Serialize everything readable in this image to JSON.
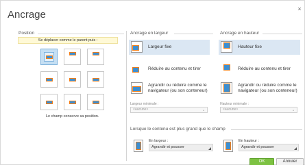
{
  "dialog": {
    "title": "Ancrage",
    "close": "×"
  },
  "position": {
    "label": "Position",
    "hint": "Se déplacer comme le parent puis :",
    "caption": "Le champ conserve sa position."
  },
  "width_anchor": {
    "label": "Ancrage en largeur",
    "options": [
      {
        "label": "Largeur fixe",
        "selected": true
      },
      {
        "label": "Réduire au contenu et tirer",
        "selected": false
      },
      {
        "label": "Agrandir ou réduire comme le navigateur (ou son conteneur)",
        "selected": false
      }
    ],
    "min_label": "Largeur minimale :",
    "min_value": "<aucune>"
  },
  "height_anchor": {
    "label": "Ancrage en hauteur",
    "options": [
      {
        "label": "Hauteur fixe",
        "selected": true
      },
      {
        "label": "Réduire au contenu et tirer",
        "selected": false
      },
      {
        "label": "Agrandir ou réduire comme le navigateur (ou son conteneur)",
        "selected": false
      }
    ],
    "min_label": "Hauteur minimale :",
    "min_value": "<aucune>"
  },
  "overflow": {
    "label": "Lorsque le contenu est plus grand que le champ",
    "width_label": "En largeur :",
    "width_value": "Agrandir et pousser",
    "height_label": "En hauteur :",
    "height_value": "Agrandir et pousser"
  },
  "buttons": {
    "ok": "OK",
    "cancel": "Annuler"
  },
  "colors": {
    "accent": "#3d8fd1",
    "border_accent": "#f07f1b",
    "ok_button": "#7dc242",
    "selection": "#dbe7f3"
  }
}
